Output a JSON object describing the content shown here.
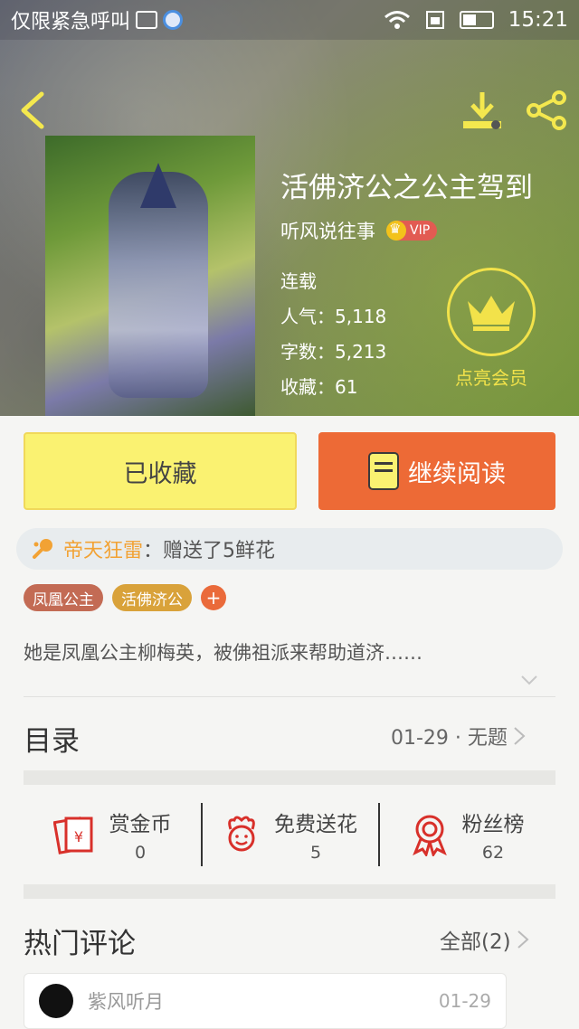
{
  "status_bar": {
    "carrier": "仅限紧急呼叫",
    "time": "15:21"
  },
  "book": {
    "title": "活佛济公之公主驾到",
    "author": "听风说往事",
    "vip_label": "VIP",
    "status": "连载",
    "popularity": "人气：5,118",
    "word_count": "字数：5,213",
    "favorites": "收藏：61"
  },
  "member": {
    "label": "点亮会员"
  },
  "actions": {
    "favorited_label": "已收藏",
    "continue_label": "继续阅读"
  },
  "gift_notice": {
    "sender": "帝天狂雷",
    "message": "：赠送了5鲜花"
  },
  "tags": [
    "凤凰公主",
    "活佛济公"
  ],
  "tag_add": "+",
  "description": "她是凤凰公主柳梅英，被佛祖派来帮助道济……",
  "toc": {
    "title": "目录",
    "latest": "01-29 · 无题"
  },
  "stats": [
    {
      "name": "赏金币",
      "value": "0",
      "icon": "red-envelope-icon"
    },
    {
      "name": "免费送花",
      "value": "5",
      "icon": "flower-icon"
    },
    {
      "name": "粉丝榜",
      "value": "62",
      "icon": "medal-icon"
    }
  ],
  "comments": {
    "title": "热门评论",
    "all_label": "全部(2)",
    "items": [
      {
        "user": "紫风听月",
        "date": "01-29"
      }
    ]
  },
  "colors": {
    "accent_orange": "#ed6a36",
    "accent_yellow": "#faf271",
    "member_gold": "#f2e24a"
  }
}
